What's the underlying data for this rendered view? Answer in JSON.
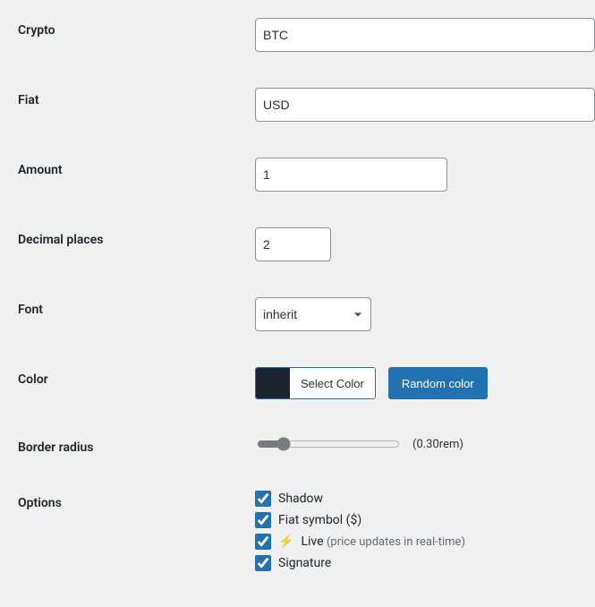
{
  "fields": {
    "crypto": {
      "label": "Crypto",
      "value": "BTC"
    },
    "fiat": {
      "label": "Fiat",
      "value": "USD"
    },
    "amount": {
      "label": "Amount",
      "value": "1"
    },
    "decimal_places": {
      "label": "Decimal places",
      "value": "2"
    },
    "font": {
      "label": "Font",
      "value": "inherit"
    },
    "color": {
      "label": "Color",
      "swatch": "#1c2431",
      "select_label": "Select Color",
      "random_label": "Random color"
    },
    "border_radius": {
      "label": "Border radius",
      "value": "0.30",
      "display": "(0.30rem)"
    },
    "options": {
      "label": "Options",
      "items": [
        {
          "key": "shadow",
          "label": "Shadow",
          "checked": true
        },
        {
          "key": "fiat_symbol",
          "label": "Fiat symbol ($)",
          "checked": true
        },
        {
          "key": "live",
          "label": "Live",
          "hint": "(price updates in real-time)",
          "checked": true,
          "emoji": "⚡"
        },
        {
          "key": "signature",
          "label": "Signature",
          "checked": true
        }
      ]
    }
  }
}
